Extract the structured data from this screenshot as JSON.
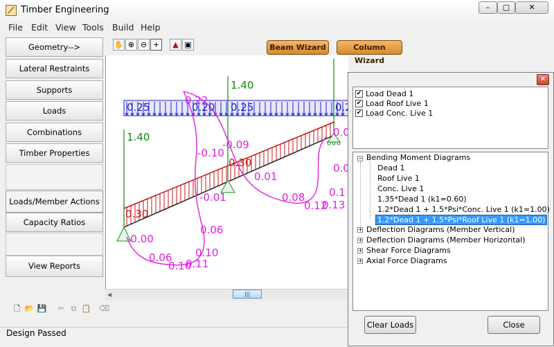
{
  "window": {
    "title": "Timber Engineering",
    "minimize_icon": "minimize-icon",
    "maximize_icon": "maximize-icon",
    "close_icon": "close-icon"
  },
  "menu": [
    "File",
    "Edit",
    "View",
    "Tools",
    "Build",
    "Help"
  ],
  "sidebar": {
    "items": [
      {
        "label": "Geometry-->"
      },
      {
        "label": "Lateral Restraints"
      },
      {
        "label": "Supports"
      },
      {
        "label": "Loads"
      },
      {
        "label": "Combinations"
      },
      {
        "label": "Timber Properties"
      },
      {
        "label": "Loads/Member Actions"
      },
      {
        "label": "Capacity Ratios"
      },
      {
        "label": "View Reports"
      }
    ]
  },
  "toolbar": {
    "icons": [
      "pan-icon",
      "zoom-in-icon",
      "zoom-out-icon",
      "crosshair-icon",
      "color-icon",
      "window-icon"
    ],
    "beam_wizard": "Beam Wizard",
    "column_wizard": "Column Wizard"
  },
  "diagram": {
    "load_labels": [
      "0.25",
      "0.20",
      "0.25",
      "0.2"
    ],
    "reactions": [
      "1.40",
      "1.40"
    ],
    "moment_labels": [
      "0.22",
      "-0.10",
      "-0.09",
      "0.30",
      "0.01",
      "0.08",
      "0.12",
      "0.13",
      "0.1",
      "0.30",
      "-0.01",
      "0.06",
      "0.10",
      "0.11",
      "0.10",
      "0.06",
      "-0.00",
      "0.0",
      "0.0"
    ],
    "colors": {
      "load": "#2020c8",
      "moment": "#e020e0",
      "reaction": "#108a10",
      "beam_load": "#c81414",
      "support": "#208a20"
    }
  },
  "bottom_toolbar": {
    "icons": [
      "new-icon",
      "open-icon",
      "save-icon",
      "cut-icon",
      "copy-icon",
      "paste-icon",
      "eraser-icon"
    ]
  },
  "status": {
    "text": "Design Passed"
  },
  "panel": {
    "load_cases": [
      {
        "label": "Load Dead 1",
        "checked": true
      },
      {
        "label": "Load Roof Live 1",
        "checked": true
      },
      {
        "label": "Load Conc. Live 1",
        "checked": true
      }
    ],
    "tree": [
      {
        "label": "Bending Moment Diagrams",
        "expanded": true,
        "children": [
          "Dead 1",
          "Roof Live 1",
          "Conc. Live 1",
          "1.35*Dead 1   (k1=0.60)",
          "1.2*Dead 1 + 1.5*Psi*Conc. Live 1   (k1=1.00)",
          "1.2*Dead 1 + 1.5*Psi*Roof Live 1   (k1=1.00)"
        ]
      },
      {
        "label": "Deflection Diagrams (Member Vertical)",
        "expanded": false
      },
      {
        "label": "Deflection Diagrams (Member Horizontal)",
        "expanded": false
      },
      {
        "label": "Shear Force Diagrams",
        "expanded": false
      },
      {
        "label": "Axial Force Diagrams",
        "expanded": false
      }
    ],
    "selected_index": 5,
    "clear_button": "Clear Loads",
    "close_button": "Close"
  }
}
